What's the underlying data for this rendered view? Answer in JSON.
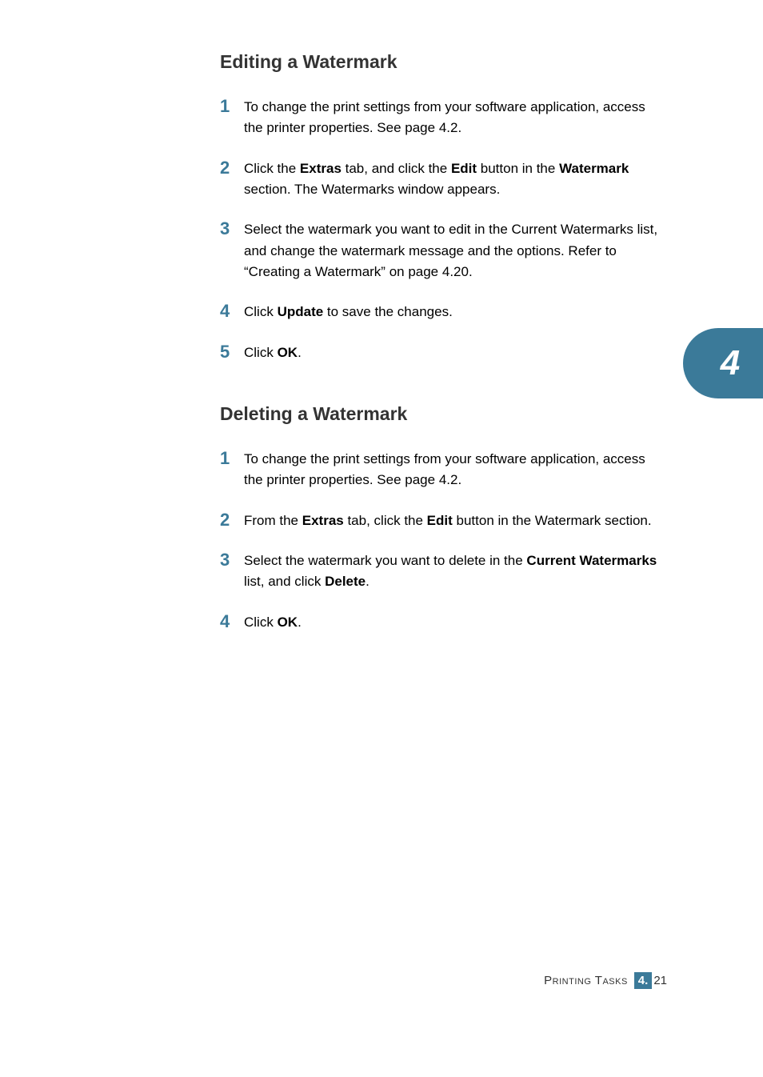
{
  "chapter_tab": "4",
  "sections": [
    {
      "heading": "Editing a Watermark",
      "steps": [
        {
          "num": "1",
          "html": "To change the print settings from your software application, access the printer properties. See page 4.2."
        },
        {
          "num": "2",
          "html": "Click the <b>Extras</b> tab, and click the <b>Edit</b> button in the <b>Watermark</b> section. The Watermarks window appears."
        },
        {
          "num": "3",
          "html": "Select the watermark you want to edit in the Current Watermarks list, and change the watermark message and the options. Refer to “Creating a Watermark” on page 4.20."
        },
        {
          "num": "4",
          "html": "Click <b>Update</b> to save the changes."
        },
        {
          "num": "5",
          "html": "Click <b>OK</b>."
        }
      ]
    },
    {
      "heading": "Deleting a Watermark",
      "steps": [
        {
          "num": "1",
          "html": "To change the print settings from your software application, access the printer properties. See page 4.2."
        },
        {
          "num": "2",
          "html": "From the <b>Extras</b> tab, click the <b>Edit</b> button in the Watermark section."
        },
        {
          "num": "3",
          "html": "Select the watermark you want to delete in the <b>Current Watermarks</b> list, and click <b>Delete</b>."
        },
        {
          "num": "4",
          "html": "Click <b>OK</b>."
        }
      ]
    }
  ],
  "footer": {
    "title": "Printing Tasks",
    "chapter": "4.",
    "page": "21"
  }
}
